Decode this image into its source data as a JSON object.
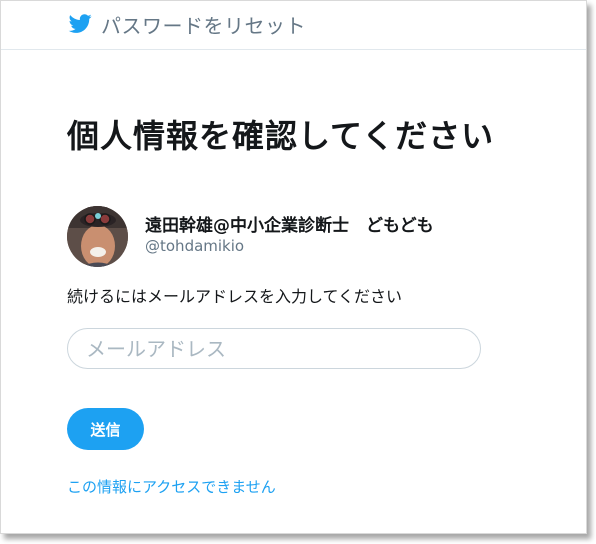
{
  "header": {
    "logo_icon": "twitter-bird-icon",
    "title": "パスワードをリセット"
  },
  "main": {
    "title": "個人情報を確認してください",
    "account": {
      "display_name": "遠田幹雄@中小企業診断士　どもども",
      "handle": "@tohdamikio"
    },
    "instruction": "続けるにはメールアドレスを入力してください",
    "email_input": {
      "value": "",
      "placeholder": "メールアドレス"
    },
    "submit_label": "送信",
    "cant_access_link": "この情報にアクセスできません"
  },
  "colors": {
    "brand": "#1da1f2",
    "muted": "#657786",
    "text": "#14171a",
    "border": "#ccd6dd"
  }
}
